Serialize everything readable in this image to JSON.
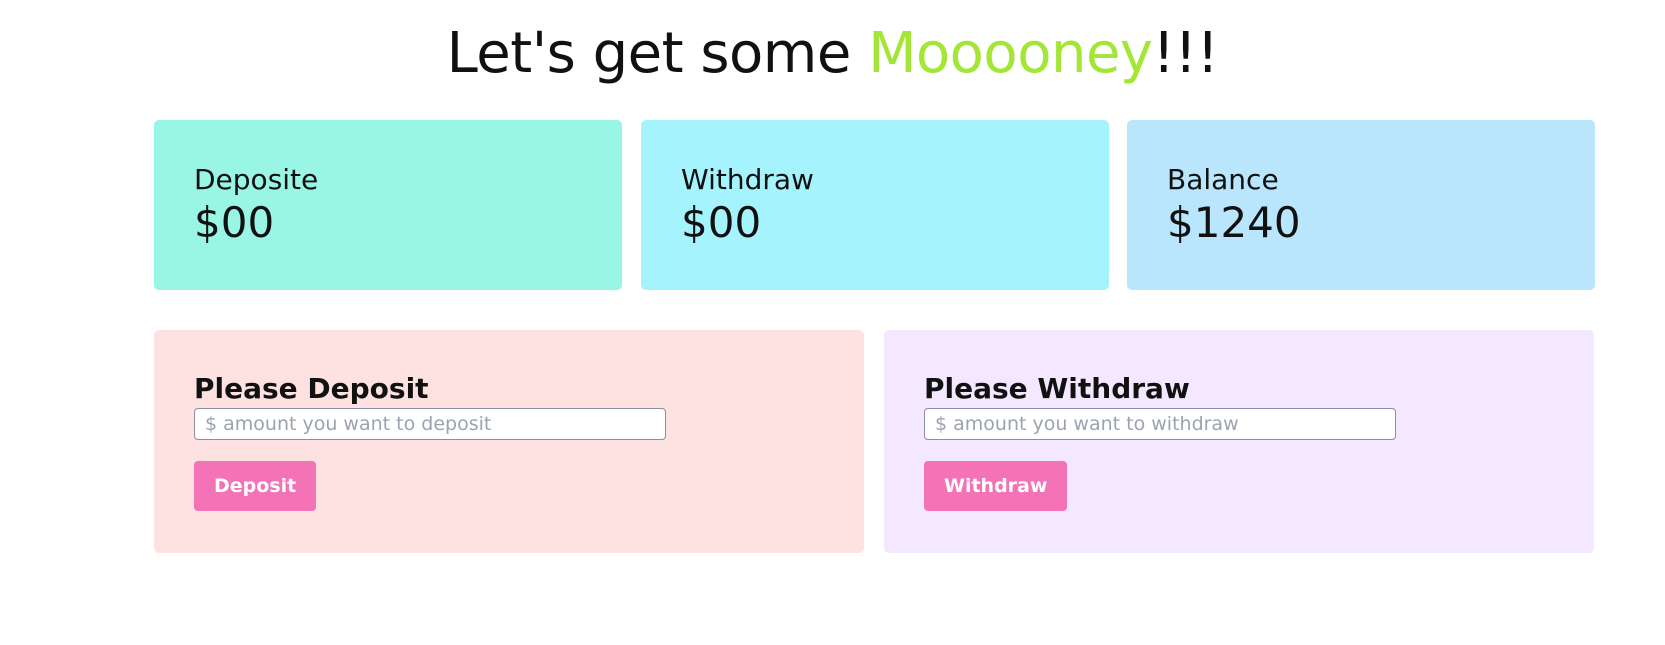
{
  "header": {
    "title_prefix": "Let's get some ",
    "title_accent": "Mooooney",
    "title_suffix": "!!!",
    "accent_color": "#a3e635"
  },
  "stats": [
    {
      "label": "Deposite",
      "value": "$00",
      "color": "#99f6e4"
    },
    {
      "label": "Withdraw",
      "value": "$00",
      "color": "#a5f3fc"
    },
    {
      "label": "Balance",
      "value": "$1240",
      "color": "#bae6fd"
    }
  ],
  "deposit_form": {
    "title": "Please Deposit",
    "input_value": "",
    "placeholder": "$ amount you want to deposit",
    "button_label": "Deposit",
    "background": "#fee2e2"
  },
  "withdraw_form": {
    "title": "Please Withdraw",
    "input_value": "",
    "placeholder": "$ amount you want to withdraw",
    "button_label": "Withdraw",
    "background": "#f3e8ff"
  },
  "button_color": "#f472b6"
}
